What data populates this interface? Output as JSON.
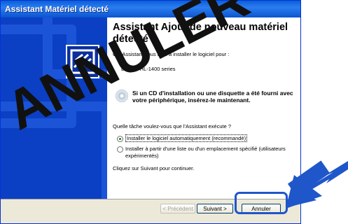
{
  "window": {
    "title": "Assistant Matériel détecté"
  },
  "wizard": {
    "heading": "Assistant Ajout de nouveau matériel détecté",
    "intro": "Cet Assistant vous aide à installer le logiciel pour :",
    "device": "Brother HL-1400 series",
    "cd_note": "Si un CD d'installation ou une disquette a été fourni avec votre périphérique, insérez-le maintenant.",
    "question": "Quelle tâche voulez-vous que l'Assistant exécute ?",
    "options": [
      {
        "label": "Installer le logiciel automatiquement (recommandé)",
        "selected": true
      },
      {
        "label": "Installer à partir d'une liste ou d'un emplacement spécifié (utilisateurs expérimentés)",
        "selected": false
      }
    ],
    "continue_text": "Cliquez sur Suivant pour continuer."
  },
  "buttons": {
    "back": "< Précédent",
    "next": "Suivant >",
    "cancel": "Annuler"
  },
  "overlay": {
    "stamp_text": "ANNULER",
    "highlight_color": "#1f56c9",
    "arrow_color": "#1f56c9"
  }
}
